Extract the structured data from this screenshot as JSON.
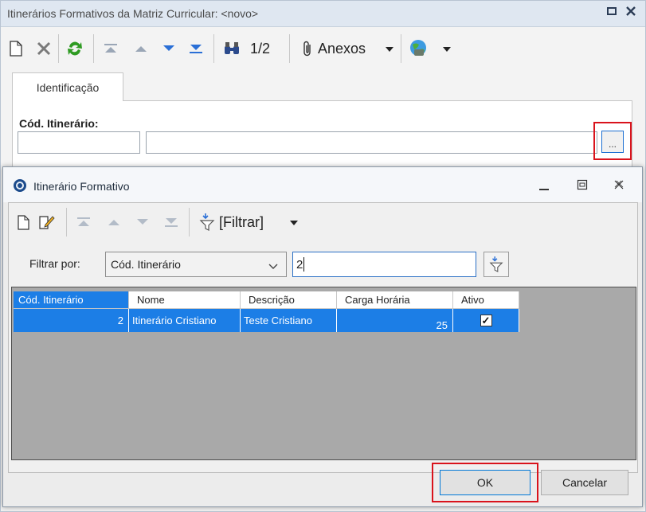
{
  "outer_window": {
    "title": "Itinerários Formativos da Matriz Curricular: <novo>",
    "restore_glyph": "▫",
    "close_glyph": "✕",
    "toolbar": {
      "record_counter": "1/2",
      "attachments_label": "Anexos"
    },
    "tab_label": "Identificação",
    "field_label": "Cód. Itinerário:",
    "lookup_button_label": "..."
  },
  "dialog": {
    "title": "Itinerário Formativo",
    "toolbar": {
      "filter_label": "[Filtrar]"
    },
    "filter": {
      "label": "Filtrar por:",
      "selected_field": "Cód. Itinerário",
      "value": "2"
    },
    "grid": {
      "columns": [
        "Cód. Itinerário",
        "Nome",
        "Descrição",
        "Carga Horária",
        "Ativo"
      ],
      "rows": [
        {
          "codigo": "2",
          "nome": "Itinerário Cristiano",
          "descricao": "Teste Cristiano",
          "carga_horaria": "25",
          "ativo": true
        }
      ]
    },
    "ok_label": "OK",
    "cancel_label": "Cancelar"
  },
  "colors": {
    "selection": "#1c7ee6",
    "highlight_box": "#d9131c",
    "refresh_green": "#2e9b22",
    "nav_blue": "#2a6fd6"
  },
  "icons": [
    "new-document-icon",
    "delete-icon",
    "refresh-icon",
    "first-record-icon",
    "previous-record-icon",
    "next-record-icon",
    "last-record-icon",
    "binoculars-icon",
    "paperclip-icon",
    "globe-icon",
    "edit-icon",
    "filter-icon"
  ]
}
